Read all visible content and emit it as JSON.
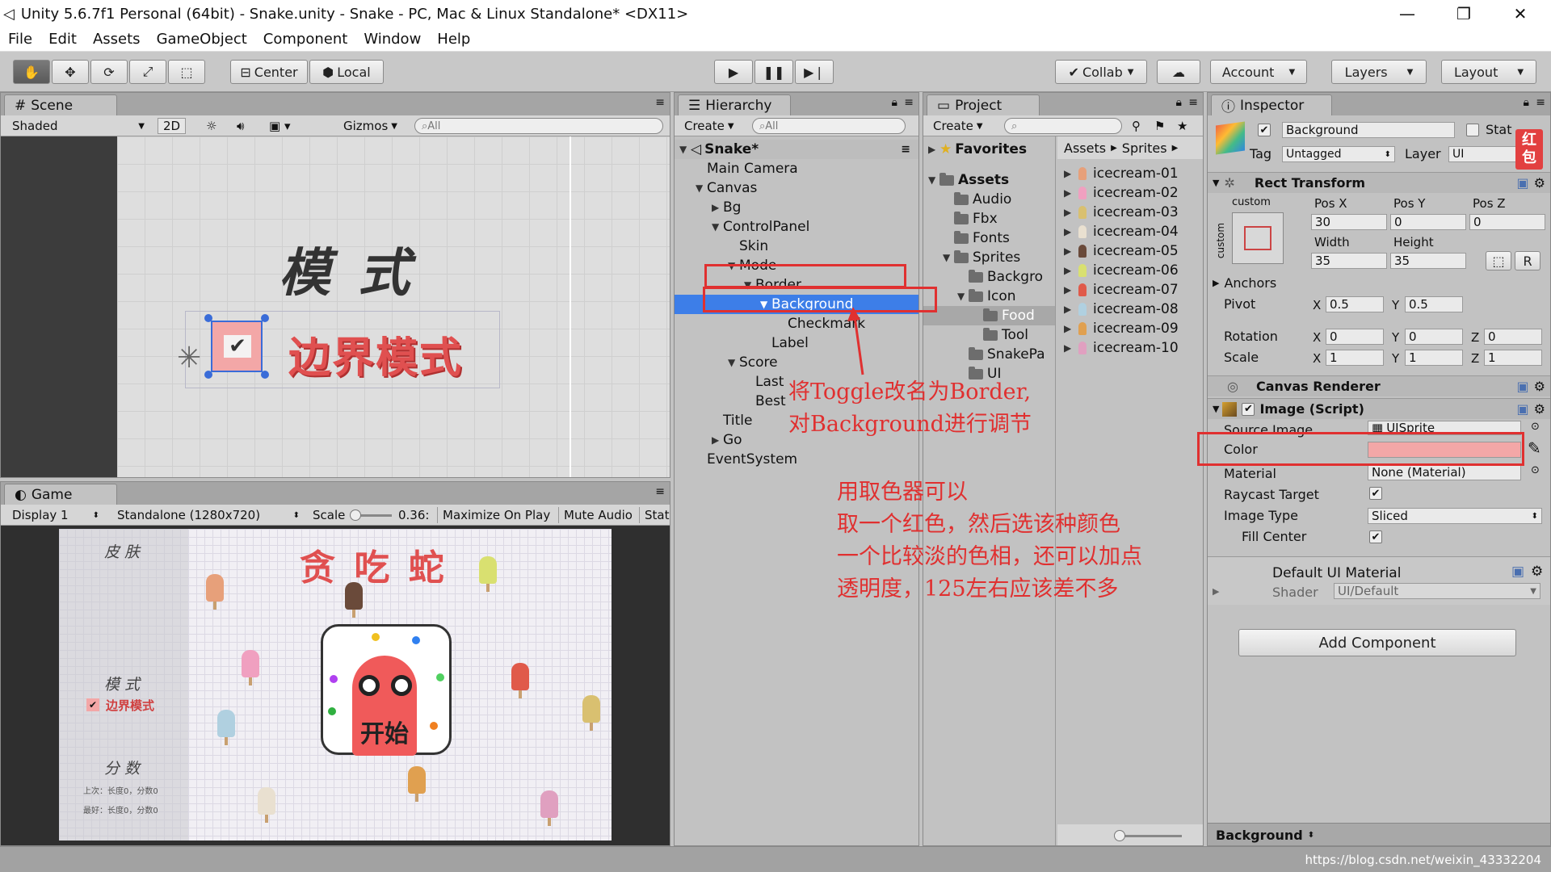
{
  "window": {
    "title": "Unity 5.6.7f1 Personal (64bit) - Snake.unity - Snake - PC, Mac & Linux Standalone* <DX11>"
  },
  "menu": [
    "File",
    "Edit",
    "Assets",
    "GameObject",
    "Component",
    "Window",
    "Help"
  ],
  "toolbar": {
    "pivot_mode": "Center",
    "pivot_space": "Local",
    "collab": "Collab",
    "account": "Account",
    "layers": "Layers",
    "layout": "Layout"
  },
  "scene": {
    "tab": "Scene",
    "shading": "Shaded",
    "mode_2d": "2D",
    "gizmos": "Gizmos",
    "search_placeholder": "All",
    "heading": "模 式",
    "toggle_label": "边界模式"
  },
  "game": {
    "tab": "Game",
    "display": "Display 1",
    "resolution": "Standalone (1280x720)",
    "scale_label": "Scale",
    "scale_value": "0.36:",
    "maximize": "Maximize On Play",
    "mute": "Mute Audio",
    "stats": "Stat",
    "title": "贪 吃 蛇",
    "skin": "皮 肤",
    "mode": "模 式",
    "mode_toggle": "边界模式",
    "score": "分 数",
    "score_line1": "上次：长度0，分数0",
    "score_line2": "最好：长度0，分数0",
    "start": "开始"
  },
  "hierarchy": {
    "tab": "Hierarchy",
    "create": "Create",
    "search_placeholder": "All",
    "scene_name": "Snake*",
    "items": [
      {
        "label": "Main Camera",
        "depth": 1,
        "arrow": ""
      },
      {
        "label": "Canvas",
        "depth": 1,
        "arrow": "▼"
      },
      {
        "label": "Bg",
        "depth": 2,
        "arrow": "▶"
      },
      {
        "label": "ControlPanel",
        "depth": 2,
        "arrow": "▼"
      },
      {
        "label": "Skin",
        "depth": 3,
        "arrow": ""
      },
      {
        "label": "Mode",
        "depth": 3,
        "arrow": "▼"
      },
      {
        "label": "Border",
        "depth": 4,
        "arrow": "▼"
      },
      {
        "label": "Background",
        "depth": 5,
        "arrow": "▼",
        "selected": true
      },
      {
        "label": "Checkmark",
        "depth": 6,
        "arrow": ""
      },
      {
        "label": "Label",
        "depth": 5,
        "arrow": ""
      },
      {
        "label": "Score",
        "depth": 3,
        "arrow": "▼"
      },
      {
        "label": "Last",
        "depth": 4,
        "arrow": ""
      },
      {
        "label": "Best",
        "depth": 4,
        "arrow": ""
      },
      {
        "label": "Title",
        "depth": 2,
        "arrow": ""
      },
      {
        "label": "Go",
        "depth": 2,
        "arrow": "▶"
      },
      {
        "label": "EventSystem",
        "depth": 1,
        "arrow": ""
      }
    ]
  },
  "project": {
    "tab": "Project",
    "create": "Create",
    "favorites": "Favorites",
    "assets": "Assets",
    "folders": [
      {
        "label": "Audio",
        "depth": 1,
        "arrow": ""
      },
      {
        "label": "Fbx",
        "depth": 1,
        "arrow": ""
      },
      {
        "label": "Fonts",
        "depth": 1,
        "arrow": ""
      },
      {
        "label": "Sprites",
        "depth": 1,
        "arrow": "▼"
      },
      {
        "label": "Backgro",
        "depth": 2,
        "arrow": ""
      },
      {
        "label": "Icon",
        "depth": 2,
        "arrow": "▼"
      },
      {
        "label": "Food",
        "depth": 3,
        "arrow": "",
        "selected": true
      },
      {
        "label": "Tool",
        "depth": 3,
        "arrow": ""
      },
      {
        "label": "SnakePa",
        "depth": 2,
        "arrow": ""
      },
      {
        "label": "UI",
        "depth": 2,
        "arrow": ""
      }
    ],
    "breadcrumb": [
      "Assets",
      "Sprites"
    ],
    "files": [
      "icecream-01",
      "icecream-02",
      "icecream-03",
      "icecream-04",
      "icecream-05",
      "icecream-06",
      "icecream-07",
      "icecream-08",
      "icecream-09",
      "icecream-10"
    ],
    "file_colors": [
      "#e7a07a",
      "#f0a0c0",
      "#d9c070",
      "#e9e0d0",
      "#6a4a3a",
      "#d9e070",
      "#e05a4a",
      "#b0d0e0",
      "#e0a050",
      "#e0a0c0"
    ]
  },
  "inspector": {
    "tab": "Inspector",
    "object_name": "Background",
    "static_label": "Stat",
    "tag_label": "Tag",
    "tag_value": "Untagged",
    "layer_label": "Layer",
    "layer_value": "UI",
    "rect_transform": "Rect Transform",
    "custom": "custom",
    "pos_x_label": "Pos X",
    "pos_y_label": "Pos Y",
    "pos_z_label": "Pos Z",
    "pos_x": "30",
    "pos_y": "0",
    "pos_z": "0",
    "width_label": "Width",
    "height_label": "Height",
    "width": "35",
    "height": "35",
    "r_btn": "R",
    "anchors": "Anchors",
    "pivot_label": "Pivot",
    "pivot_x": "0.5",
    "pivot_y": "0.5",
    "rotation_label": "Rotation",
    "rot_x": "0",
    "rot_y": "0",
    "rot_z": "0",
    "scale_label": "Scale",
    "scale_x": "1",
    "scale_y": "1",
    "scale_z": "1",
    "x": "X",
    "y": "Y",
    "z": "Z",
    "canvas_renderer": "Canvas Renderer",
    "image_script": "Image (Script)",
    "source_image_label": "Source Image",
    "source_image": "UISprite",
    "color_label": "Color",
    "color_value": "#f3a7a7",
    "material_label": "Material",
    "material_value": "None (Material)",
    "raycast_label": "Raycast Target",
    "image_type_label": "Image Type",
    "image_type": "Sliced",
    "fill_center_label": "Fill Center",
    "default_material": "Default UI Material",
    "shader_label": "Shader",
    "shader_value": "UI/Default",
    "add_component": "Add Component",
    "footer": "Background"
  },
  "annotations": {
    "note1_line1": "将Toggle改名为Border,",
    "note1_line2": "对Background进行调节",
    "note2_lines": [
      "用取色器可以",
      "取一个红色，然后选该种颜色",
      "一个比较淡的色相，还可以加点",
      "透明度，125左右应该差不多"
    ]
  },
  "side_badge": "红包",
  "watermark": "https://blog.csdn.net/weixin_43332204",
  "colors": {
    "selection": "#3d7ee8",
    "annotation": "#e03030",
    "toggle_bg": "#f3a7a7",
    "snake": "#f05a5a"
  }
}
